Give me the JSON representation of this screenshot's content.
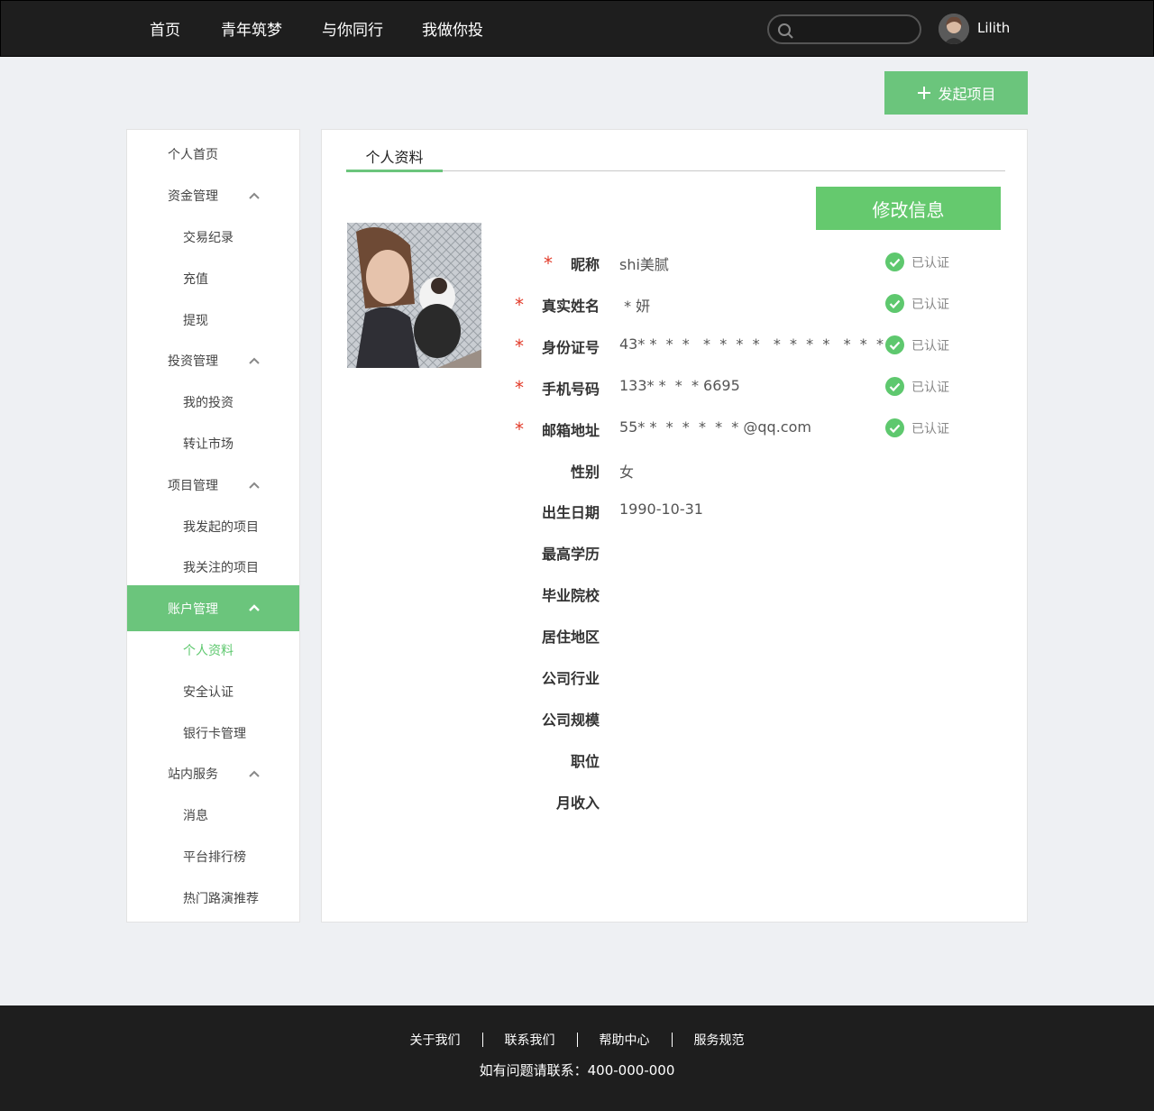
{
  "nav": {
    "items": [
      "首页",
      "青年筑梦",
      "与你同行",
      "我做你投"
    ],
    "search_placeholder": "",
    "user_name": "Lilith"
  },
  "launch_button": "发起项目",
  "sidebar": {
    "items": [
      {
        "label": "个人首页",
        "kind": "group"
      },
      {
        "label": "资金管理",
        "kind": "group",
        "expanded": true
      },
      {
        "label": "交易纪录",
        "kind": "sub"
      },
      {
        "label": "充值",
        "kind": "sub"
      },
      {
        "label": "提现",
        "kind": "sub"
      },
      {
        "label": "投资管理",
        "kind": "group",
        "expanded": true
      },
      {
        "label": "我的投资",
        "kind": "sub"
      },
      {
        "label": "转让市场",
        "kind": "sub"
      },
      {
        "label": "项目管理",
        "kind": "group",
        "expanded": true
      },
      {
        "label": "我发起的项目",
        "kind": "sub"
      },
      {
        "label": "我关注的项目",
        "kind": "sub"
      },
      {
        "label": "账户管理",
        "kind": "group",
        "expanded": true,
        "active": true
      },
      {
        "label": "个人资料",
        "kind": "sub",
        "active": true
      },
      {
        "label": "安全认证",
        "kind": "sub"
      },
      {
        "label": "银行卡管理",
        "kind": "sub"
      },
      {
        "label": "站内服务",
        "kind": "group",
        "expanded": true
      },
      {
        "label": "消息",
        "kind": "sub"
      },
      {
        "label": "平台排行榜",
        "kind": "sub"
      },
      {
        "label": "热门路演推荐",
        "kind": "sub"
      }
    ]
  },
  "main": {
    "tab": "个人资料",
    "edit_button": "修改信息",
    "fields": [
      {
        "label": "昵称",
        "value": "shi美腻",
        "required": true,
        "verified": "已认证"
      },
      {
        "label": "真实姓名",
        "value": " * 妍",
        "required": true,
        "verified": "已认证"
      },
      {
        "label": "身份证号",
        "value": "43* *  *  *   *  *  *  *   *  *  *  *   *  *  *  *",
        "required": true,
        "verified": "已认证"
      },
      {
        "label": "手机号码",
        "value": "133* *  *  * 6695",
        "required": true,
        "verified": "已认证"
      },
      {
        "label": "邮箱地址",
        "value": "55* *  *  *  *  *  * @qq.com",
        "required": true,
        "verified": "已认证"
      },
      {
        "label": "性别",
        "value": "女",
        "required": false,
        "verified": ""
      },
      {
        "label": "出生日期",
        "value": "1990-10-31",
        "required": false,
        "verified": ""
      },
      {
        "label": "最高学历",
        "value": "",
        "required": false,
        "verified": ""
      },
      {
        "label": "毕业院校",
        "value": "",
        "required": false,
        "verified": ""
      },
      {
        "label": "居住地区",
        "value": "",
        "required": false,
        "verified": ""
      },
      {
        "label": "公司行业",
        "value": "",
        "required": false,
        "verified": ""
      },
      {
        "label": "公司规模",
        "value": "",
        "required": false,
        "verified": ""
      },
      {
        "label": "职位",
        "value": "",
        "required": false,
        "verified": ""
      },
      {
        "label": "月收入",
        "value": "",
        "required": false,
        "verified": ""
      }
    ]
  },
  "footer": {
    "links": [
      "关于我们",
      "联系我们",
      "帮助中心",
      "服务规范"
    ],
    "contact": "如有问题请联系：400-000-000"
  },
  "colors": {
    "accent": "#6bc57c",
    "required": "#e23b2a",
    "topbar": "#1e1e1e",
    "background": "#eef0f3"
  },
  "icons": {
    "search": "search-icon",
    "plus": "plus-icon",
    "chevron": "chevron-up-icon",
    "verified": "check-circle-icon"
  }
}
